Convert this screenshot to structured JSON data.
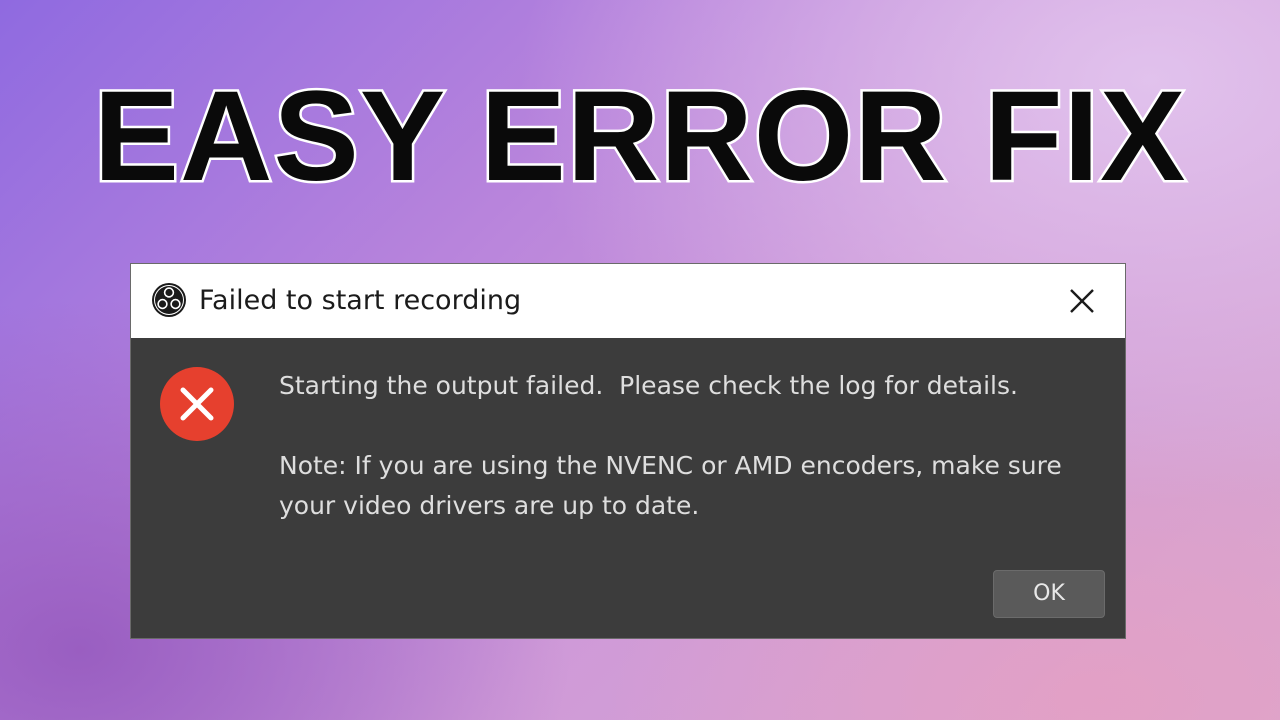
{
  "headline": "EASY ERROR FIX",
  "dialog": {
    "title": "Failed to start recording",
    "app_icon": "obs-logo-icon",
    "close_icon": "close-icon",
    "error_icon": "error-x-icon",
    "message": "Starting the output failed.  Please check the log for details.",
    "note": "Note: If you are using the NVENC or AMD encoders, make sure your video drivers are up to date.",
    "ok_label": "OK"
  },
  "colors": {
    "dialog_body": "#3c3c3c",
    "titlebar": "#ffffff",
    "error_red": "#e6402e",
    "button": "#5a5a5a"
  }
}
